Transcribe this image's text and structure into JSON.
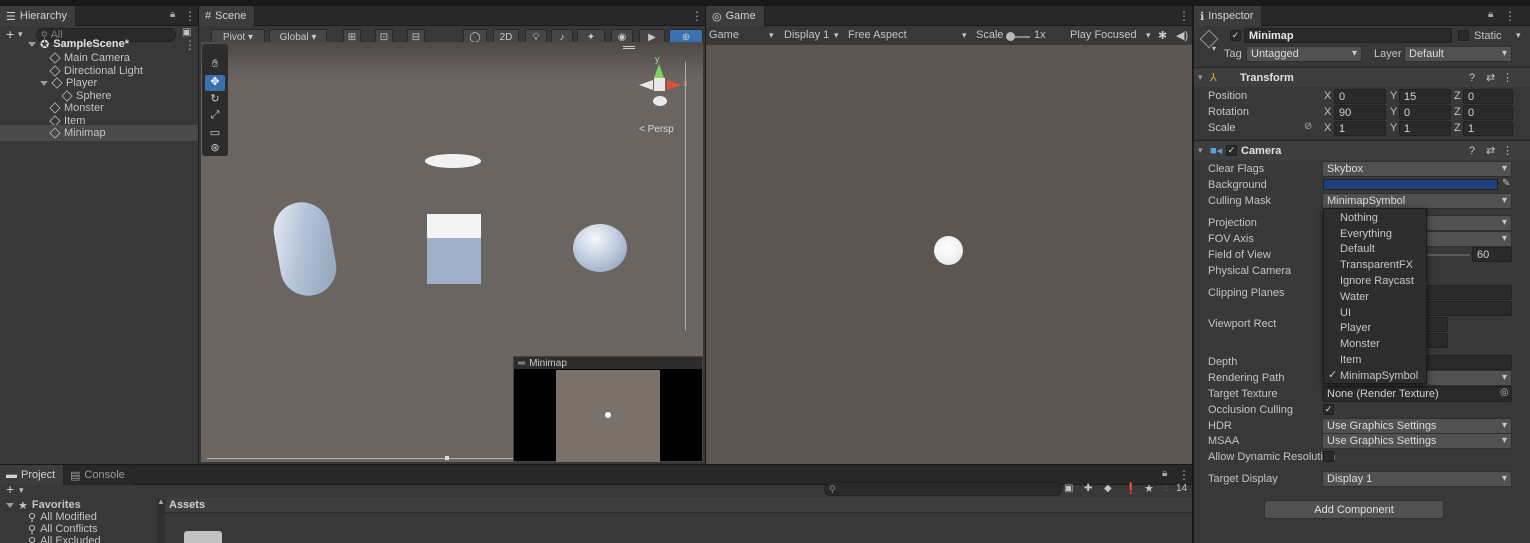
{
  "hierarchy": {
    "tab": "Hierarchy",
    "search_placeholder": "All",
    "scene": "SampleScene*",
    "items": [
      "Main Camera",
      "Directional Light",
      "Player",
      "Sphere",
      "Monster",
      "Item",
      "Minimap"
    ]
  },
  "scene_view": {
    "tab": "Scene",
    "pivot": "Pivot",
    "global": "Global",
    "mode_2d": "2D",
    "persp": "< Persp",
    "gizmo_y": "y",
    "gizmo_x": "x",
    "minimap_title": "Minimap"
  },
  "game_view": {
    "tab": "Game",
    "mode": "Game",
    "display": "Display 1",
    "aspect": "Free Aspect",
    "scale_label": "Scale",
    "scale_value": "1x",
    "play_mode": "Play Focused"
  },
  "inspector": {
    "tab": "Inspector",
    "object_name": "Minimap",
    "static_label": "Static",
    "tag_label": "Tag",
    "tag_value": "Untagged",
    "layer_label": "Layer",
    "layer_value": "Default",
    "transform": {
      "title": "Transform",
      "position_label": "Position",
      "rotation_label": "Rotation",
      "scale_label": "Scale",
      "position": {
        "x": "0",
        "y": "15",
        "z": "0"
      },
      "rotation": {
        "x": "90",
        "y": "0",
        "z": "0"
      },
      "scale": {
        "x": "1",
        "y": "1",
        "z": "1"
      },
      "axis_x": "X",
      "axis_y": "Y",
      "axis_z": "Z"
    },
    "camera": {
      "title": "Camera",
      "clear_flags_label": "Clear Flags",
      "clear_flags_value": "Skybox",
      "background_label": "Background",
      "background_color": "#1f3f7d",
      "culling_mask_label": "Culling Mask",
      "culling_mask_value": "MinimapSymbol",
      "projection_label": "Projection",
      "fov_axis_label": "FOV Axis",
      "fov_label": "Field of View",
      "fov_value": "60",
      "physical_camera_label": "Physical Camera",
      "clipping_label": "Clipping Planes",
      "viewport_label": "Viewport Rect",
      "depth_label": "Depth",
      "rendering_path_label": "Rendering Path",
      "target_texture_label": "Target Texture",
      "target_texture_value": "None (Render Texture)",
      "occlusion_label": "Occlusion Culling",
      "hdr_label": "HDR",
      "hdr_value": "Use Graphics Settings",
      "msaa_label": "MSAA",
      "msaa_value": "Use Graphics Settings",
      "dynamic_res_label": "Allow Dynamic Resolution",
      "target_display_label": "Target Display",
      "target_display_value": "Display 1"
    },
    "layer_menu": [
      "Nothing",
      "Everything",
      "Default",
      "TransparentFX",
      "Ignore Raycast",
      "Water",
      "UI",
      "Player",
      "Monster",
      "Item",
      "MinimapSymbol"
    ],
    "layer_menu_checked": "MinimapSymbol",
    "check_mark": "✓",
    "add_component": "Add Component"
  },
  "project": {
    "tab_project": "Project",
    "tab_console": "Console",
    "favorites": "Favorites",
    "fav_items": [
      "All Modified",
      "All Conflicts",
      "All Excluded"
    ],
    "assets": "Assets",
    "count": "14"
  },
  "colors": {
    "accent": "#3a72b0",
    "scene_bg": "#6b6562",
    "game_bg": "#5d5650"
  }
}
